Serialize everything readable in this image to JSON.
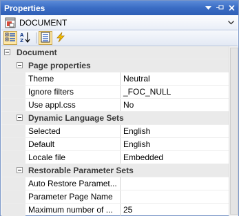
{
  "window": {
    "title": "Properties"
  },
  "window_controls": {
    "dropdown": "▾",
    "pin": "⊣",
    "close": "✕"
  },
  "object_selector": {
    "value": "DOCUMENT"
  },
  "categories": {
    "root": "Document",
    "page": "Page properties",
    "lang": "Dynamic Language Sets",
    "restore": "Restorable Parameter Sets"
  },
  "rows": {
    "theme": {
      "name": "Theme",
      "value": "Neutral"
    },
    "ignore_filters": {
      "name": "Ignore filters",
      "value": "_FOC_NULL"
    },
    "use_appl_css": {
      "name": "Use appl.css",
      "value": "No"
    },
    "selected": {
      "name": "Selected",
      "value": "English"
    },
    "default": {
      "name": "Default",
      "value": "English"
    },
    "locale_file": {
      "name": "Locale file",
      "value": "Embedded"
    },
    "auto_restore": {
      "name": "Auto Restore Paramet...",
      "value": ""
    },
    "param_page_name": {
      "name": "Parameter Page Name",
      "value": ""
    },
    "max_number": {
      "name": "Maximum number of ...",
      "value": "25"
    }
  },
  "colors": {
    "title_bar": "#3a6cc4",
    "category_bg": "#eaeaea",
    "active_button": "#ffe8a6"
  }
}
